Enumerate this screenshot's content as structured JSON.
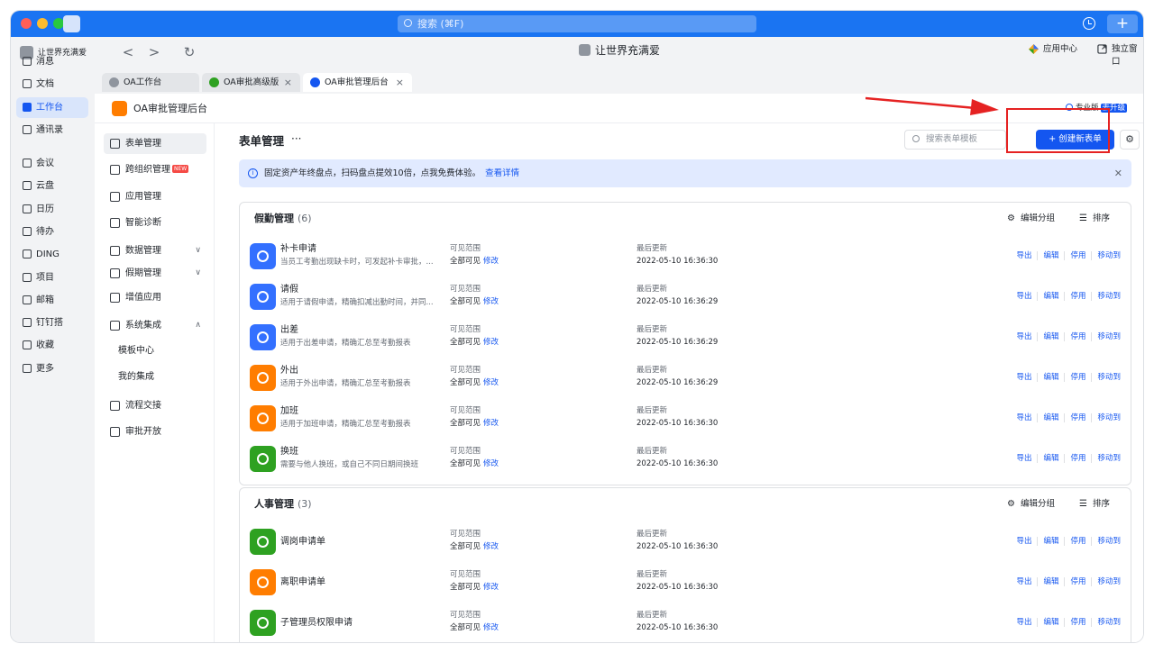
{
  "window": {
    "search_placeholder": "搜索 (⌘F)",
    "plus_label": "+"
  },
  "nav": {
    "org_name": "让世界充满爱",
    "items": [
      {
        "label": "消息"
      },
      {
        "label": "文档"
      },
      {
        "label": "工作台",
        "active": true
      },
      {
        "label": "通讯录"
      },
      {
        "label": "会议"
      },
      {
        "label": "云盘"
      },
      {
        "label": "日历"
      },
      {
        "label": "待办"
      },
      {
        "label": "DING"
      },
      {
        "label": "项目"
      },
      {
        "label": "邮箱"
      },
      {
        "label": "钉钉搭"
      },
      {
        "label": "收藏"
      },
      {
        "label": "更多"
      }
    ]
  },
  "toolbar": {
    "back": "<",
    "forward": ">",
    "refresh": "↻",
    "title": "让世界充满爱",
    "app_center": "应用中心",
    "detach": "独立窗口"
  },
  "tabs": [
    {
      "label": "OA工作台"
    },
    {
      "label": "OA审批高级版"
    },
    {
      "label": "OA审批管理后台",
      "active": true
    }
  ],
  "page": {
    "title": "OA审批管理后台",
    "edition": "专业版",
    "upgrade": "去升级"
  },
  "side": {
    "items": [
      {
        "label": "表单管理",
        "active": true
      },
      {
        "label": "跨组织管理",
        "badge": "NEW"
      },
      {
        "label": "应用管理"
      },
      {
        "label": "智能诊断"
      },
      {
        "label": "数据管理",
        "chevron": "∨"
      },
      {
        "label": "假期管理",
        "chevron": "∨"
      },
      {
        "label": "增值应用"
      },
      {
        "label": "系统集成",
        "chevron": "∧"
      },
      {
        "label": "模板中心",
        "sub": true
      },
      {
        "label": "我的集成",
        "sub": true
      },
      {
        "label": "流程交接"
      },
      {
        "label": "审批开放"
      }
    ]
  },
  "main": {
    "title": "表单管理",
    "more": "···",
    "search_placeholder": "搜索表单模板",
    "create_label": "+ 创建新表单",
    "notice": "固定资产年终盘点，扫码盘点提效10倍，点我免费体验。",
    "notice_link": "查看详情",
    "edit_group": "编辑分组",
    "sort": "排序",
    "col_scope": "可见范围",
    "scope_value": "全部可见",
    "modify": "修改",
    "col_updated": "最后更新",
    "actions": [
      "导出",
      "编辑",
      "停用",
      "移动到"
    ]
  },
  "groups": [
    {
      "name": "假勤管理",
      "count": "(6)",
      "rows": [
        {
          "name": "补卡申请",
          "desc": "当员工考勤出现缺卡时，可发起补卡审批，...",
          "updated": "2022-05-10 16:36:30",
          "color": "#3370ff"
        },
        {
          "name": "请假",
          "desc": "适用于请假申请，精确扣减出勤时间，并同...",
          "updated": "2022-05-10 16:36:29",
          "color": "#3370ff"
        },
        {
          "name": "出差",
          "desc": "适用于出差申请，精确汇总至考勤报表",
          "updated": "2022-05-10 16:36:29",
          "color": "#3370ff"
        },
        {
          "name": "外出",
          "desc": "适用于外出申请，精确汇总至考勤报表",
          "updated": "2022-05-10 16:36:29",
          "color": "#ff7d00"
        },
        {
          "name": "加班",
          "desc": "适用于加班申请，精确汇总至考勤报表",
          "updated": "2022-05-10 16:36:30",
          "color": "#ff7d00"
        },
        {
          "name": "换班",
          "desc": "需要与他人换班，或自己不同日期间换班",
          "updated": "2022-05-10 16:36:30",
          "color": "#2ea121"
        }
      ]
    },
    {
      "name": "人事管理",
      "count": "(3)",
      "rows": [
        {
          "name": "调岗申请单",
          "desc": "",
          "updated": "2022-05-10 16:36:30",
          "color": "#2ea121"
        },
        {
          "name": "离职申请单",
          "desc": "",
          "updated": "2022-05-10 16:36:30",
          "color": "#ff7d00"
        },
        {
          "name": "子管理员权限申请",
          "desc": "",
          "updated": "2022-05-10 16:36:30",
          "color": "#2ea121"
        }
      ]
    }
  ]
}
